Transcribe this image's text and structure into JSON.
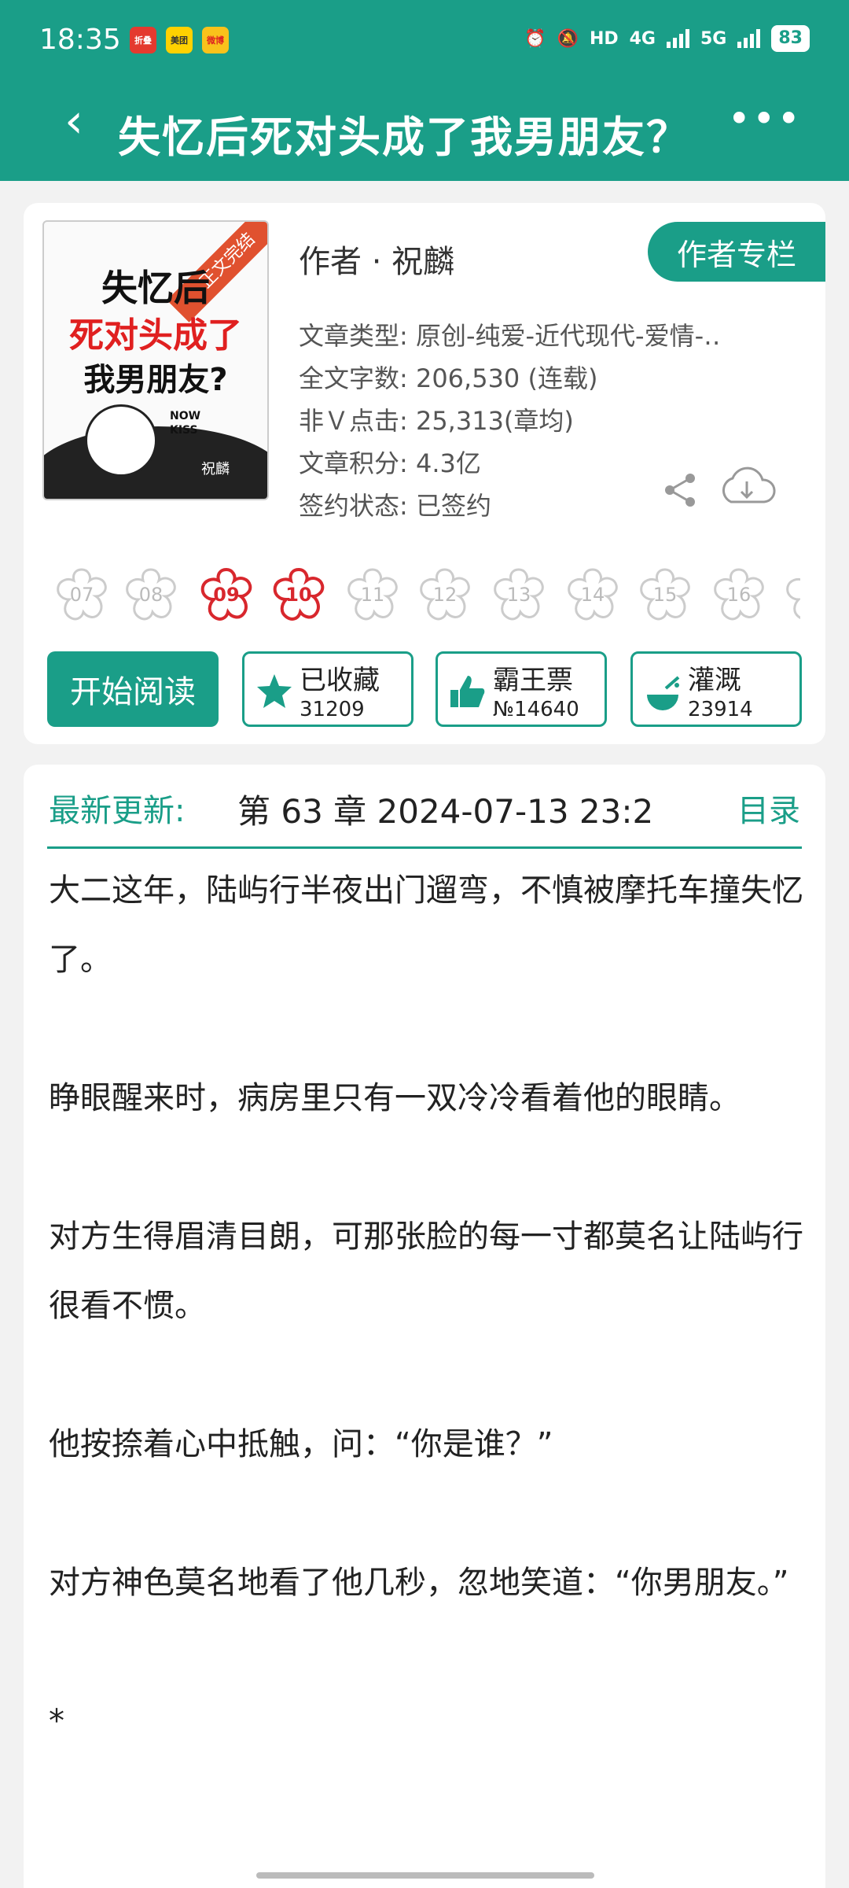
{
  "status": {
    "time": "18:35",
    "app_icons": [
      "折叠",
      "美团",
      "微博"
    ],
    "network1": "4G",
    "network2": "5G",
    "battery": "83"
  },
  "header": {
    "back_icon": "chevron-left",
    "title": "失忆后死对头成了我男朋友？",
    "more_icon": "more-dots"
  },
  "book": {
    "cover": {
      "ribbon": "正文完结",
      "line1": "失忆后",
      "line2": "死对头成了",
      "line3": "我男朋友?",
      "sticker": "NOW KISS",
      "sign": "祝麟"
    },
    "author_label": "作者 · 祝麟",
    "author_column_button": "作者专栏",
    "meta": {
      "type": "文章类型: 原创-纯爱-近代现代-爱情-‥",
      "words": "全文字数: 206,530 (连载)",
      "clicks": "非Ｖ点击: 25,313(章均)",
      "score": "文章积分: 4.3亿",
      "contract": "签约状态: 已签约"
    },
    "flowers": [
      "07",
      "08",
      "09",
      "10",
      "11",
      "12",
      "13",
      "14",
      "15",
      "16"
    ],
    "active_flowers": [
      "09",
      "10"
    ],
    "buttons": {
      "read": "开始阅读",
      "favorite": {
        "label": "已收藏",
        "count": "31209"
      },
      "vote": {
        "label": "霸王票",
        "count": "№14640"
      },
      "water": {
        "label": "灌溉",
        "count": "23914"
      }
    }
  },
  "update": {
    "label": "最新更新:",
    "text": "第 63 章  2024-07-13 23:2",
    "toc_link": "目录"
  },
  "intro": {
    "paragraphs": [
      "大二这年，陆屿行半夜出门遛弯，不慎被摩托车撞失忆了。",
      "睁眼醒来时，病房里只有一双冷冷看着他的眼睛。",
      "对方生得眉清目朗，可那张脸的每一寸都莫名让陆屿行很看不惯。",
      "他按捺着心中抵触，问：“你是谁？”",
      "对方神色莫名地看了他几秒，忽地笑道：“你男朋友。”",
      "*"
    ]
  },
  "colors": {
    "accent": "#1a9e88",
    "flower_active": "#d8272d"
  }
}
